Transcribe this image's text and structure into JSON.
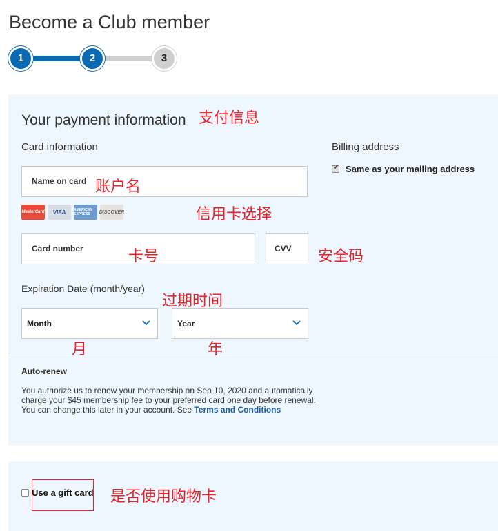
{
  "header": {
    "title": "Become a Club member"
  },
  "stepper": {
    "steps": [
      "1",
      "2",
      "3"
    ],
    "current_step": 2
  },
  "payment": {
    "title": "Your payment information",
    "card_info_label": "Card information",
    "name_on_card_label": "Name on card",
    "card_logos": [
      "MasterCard",
      "VISA",
      "AMERICAN EXPRESS",
      "DISCOVER",
      "",
      ""
    ],
    "card_number_label": "Card number",
    "cvv_label": "CVV",
    "expiration_label": "Expiration Date (month/year)",
    "month_select": "Month",
    "year_select": "Year"
  },
  "billing": {
    "title": "Billing address",
    "same_as_mailing_label": "Same as your mailing address",
    "same_as_mailing_checked": true
  },
  "auto_renew": {
    "title": "Auto-renew",
    "line1": "You authorize us to renew your membership on Sep 10, 2020 and automatically",
    "line2": "charge your $45 membership fee to your preferred card one day before renewal.",
    "line3": "You can change this later in your account. See ",
    "terms_link": "Terms and Conditions"
  },
  "gift": {
    "label": "Use a gift card",
    "checked": false
  },
  "annotations": {
    "payment_info": "支付信息",
    "account_name": "账户名",
    "card_select": "信用卡选择",
    "card_number": "卡号",
    "security_code": "安全码",
    "expiry_time": "过期时间",
    "month": "月",
    "year": "年",
    "use_gift_card": "是否使用购物卡"
  },
  "colors": {
    "accent": "#0a6ab4",
    "panel_bg": "#eef7fd",
    "annotation": "#e8222b",
    "link": "#1a5ea9"
  }
}
